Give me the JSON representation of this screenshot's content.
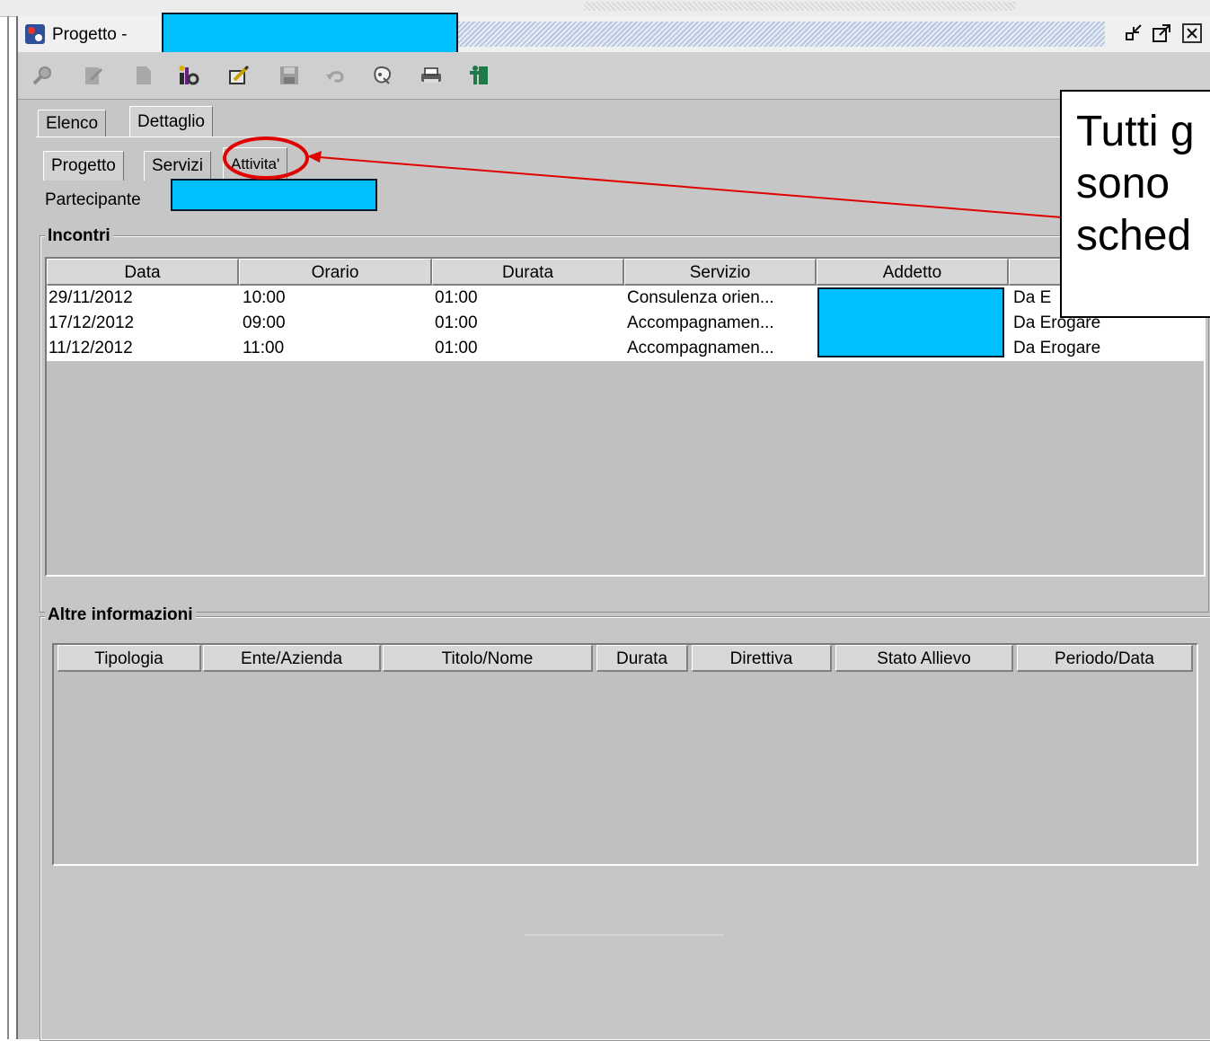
{
  "window": {
    "title": "Progetto -"
  },
  "tabs_top": [
    "Elenco",
    "Dettaglio"
  ],
  "tabs_sub": [
    "Progetto",
    "Servizi",
    "Attivita'"
  ],
  "participant": {
    "label": "Partecipante"
  },
  "incontri": {
    "title": "Incontri",
    "columns": [
      "Data",
      "Orario",
      "Durata",
      "Servizio",
      "Addetto",
      ""
    ],
    "rows": [
      [
        "29/11/2012",
        "10:00",
        "01:00",
        "Consulenza orien...",
        "",
        "Da E"
      ],
      [
        "17/12/2012",
        "09:00",
        "01:00",
        "Accompagnamen...",
        "",
        "Da Erogare"
      ],
      [
        "11/12/2012",
        "11:00",
        "01:00",
        "Accompagnamen...",
        "",
        "Da Erogare"
      ]
    ]
  },
  "altre": {
    "title": "Altre informazioni",
    "columns": [
      "Tipologia",
      "Ente/Azienda",
      "Titolo/Nome",
      "Durata",
      "Direttiva",
      "Stato Allievo",
      "Periodo/Data"
    ]
  },
  "callout": {
    "lines": [
      "Tutti g",
      "sono",
      "sched"
    ]
  },
  "colors": {
    "redaction": "#00bfff",
    "annotation": "#e00000",
    "window_bg": "#c6c6c6"
  },
  "icons": {
    "toolbar": [
      "search-icon",
      "edit-icon",
      "new-document-icon",
      "info-icon",
      "modify-icon",
      "save-icon",
      "undo-icon",
      "help-icon",
      "print-icon",
      "exit-icon"
    ],
    "titlebar": [
      "restore-icon",
      "maximize-icon",
      "close-icon"
    ]
  }
}
